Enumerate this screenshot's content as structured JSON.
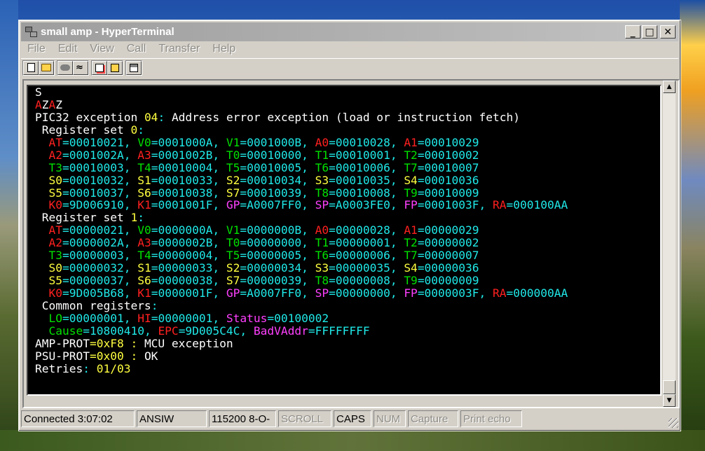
{
  "window": {
    "title": "small amp - HyperTerminal",
    "min_glyph": "_",
    "max_glyph": "□",
    "close_glyph": "✕"
  },
  "menu": [
    "File",
    "Edit",
    "View",
    "Call",
    "Transfer",
    "Help"
  ],
  "toolbar": {
    "icons": [
      "new-icon",
      "open-icon",
      "dial-icon",
      "disconnect-icon",
      "send-icon",
      "receive-icon",
      "properties-icon"
    ]
  },
  "terminal": {
    "lines": [
      [
        {
          "t": "S",
          "c": "wht"
        }
      ],
      [
        {
          "t": "A",
          "c": "red"
        },
        {
          "t": "Z",
          "c": "wht"
        },
        {
          "t": "A",
          "c": "red"
        },
        {
          "t": "Z",
          "c": "wht"
        }
      ],
      [
        {
          "t": "PIC32 exception ",
          "c": "wht"
        },
        {
          "t": "04",
          "c": "yel"
        },
        {
          "t": ": ",
          "c": "cyn"
        },
        {
          "t": "Address error exception (load or instruction fetch)",
          "c": "wht"
        }
      ],
      [
        {
          "t": " Register set ",
          "c": "wht"
        },
        {
          "t": "0",
          "c": "yel"
        },
        {
          "t": ":",
          "c": "cyn"
        }
      ],
      [
        {
          "t": "  ",
          "c": "wht"
        },
        {
          "t": "AT",
          "c": "red"
        },
        {
          "t": "=00010021, ",
          "c": "cyn"
        },
        {
          "t": "V0",
          "c": "grn"
        },
        {
          "t": "=0001000A, ",
          "c": "cyn"
        },
        {
          "t": "V1",
          "c": "grn"
        },
        {
          "t": "=0001000B, ",
          "c": "cyn"
        },
        {
          "t": "A0",
          "c": "red"
        },
        {
          "t": "=00010028, ",
          "c": "cyn"
        },
        {
          "t": "A1",
          "c": "red"
        },
        {
          "t": "=00010029",
          "c": "cyn"
        }
      ],
      [
        {
          "t": "  ",
          "c": "wht"
        },
        {
          "t": "A2",
          "c": "red"
        },
        {
          "t": "=0001002A, ",
          "c": "cyn"
        },
        {
          "t": "A3",
          "c": "red"
        },
        {
          "t": "=0001002B, ",
          "c": "cyn"
        },
        {
          "t": "T0",
          "c": "grn"
        },
        {
          "t": "=00010000, ",
          "c": "cyn"
        },
        {
          "t": "T1",
          "c": "grn"
        },
        {
          "t": "=00010001, ",
          "c": "cyn"
        },
        {
          "t": "T2",
          "c": "grn"
        },
        {
          "t": "=00010002",
          "c": "cyn"
        }
      ],
      [
        {
          "t": "  ",
          "c": "wht"
        },
        {
          "t": "T3",
          "c": "grn"
        },
        {
          "t": "=00010003, ",
          "c": "cyn"
        },
        {
          "t": "T4",
          "c": "grn"
        },
        {
          "t": "=00010004, ",
          "c": "cyn"
        },
        {
          "t": "T5",
          "c": "grn"
        },
        {
          "t": "=00010005, ",
          "c": "cyn"
        },
        {
          "t": "T6",
          "c": "grn"
        },
        {
          "t": "=00010006, ",
          "c": "cyn"
        },
        {
          "t": "T7",
          "c": "grn"
        },
        {
          "t": "=00010007",
          "c": "cyn"
        }
      ],
      [
        {
          "t": "  ",
          "c": "wht"
        },
        {
          "t": "S0",
          "c": "yel"
        },
        {
          "t": "=00010032, ",
          "c": "cyn"
        },
        {
          "t": "S1",
          "c": "yel"
        },
        {
          "t": "=00010033, ",
          "c": "cyn"
        },
        {
          "t": "S2",
          "c": "yel"
        },
        {
          "t": "=00010034, ",
          "c": "cyn"
        },
        {
          "t": "S3",
          "c": "yel"
        },
        {
          "t": "=00010035, ",
          "c": "cyn"
        },
        {
          "t": "S4",
          "c": "yel"
        },
        {
          "t": "=00010036",
          "c": "cyn"
        }
      ],
      [
        {
          "t": "  ",
          "c": "wht"
        },
        {
          "t": "S5",
          "c": "yel"
        },
        {
          "t": "=00010037, ",
          "c": "cyn"
        },
        {
          "t": "S6",
          "c": "yel"
        },
        {
          "t": "=00010038, ",
          "c": "cyn"
        },
        {
          "t": "S7",
          "c": "yel"
        },
        {
          "t": "=00010039, ",
          "c": "cyn"
        },
        {
          "t": "T8",
          "c": "grn"
        },
        {
          "t": "=00010008, ",
          "c": "cyn"
        },
        {
          "t": "T9",
          "c": "grn"
        },
        {
          "t": "=00010009",
          "c": "cyn"
        }
      ],
      [
        {
          "t": "  ",
          "c": "wht"
        },
        {
          "t": "K0",
          "c": "red"
        },
        {
          "t": "=9D006910, ",
          "c": "cyn"
        },
        {
          "t": "K1",
          "c": "red"
        },
        {
          "t": "=0001001F, ",
          "c": "cyn"
        },
        {
          "t": "GP",
          "c": "mag"
        },
        {
          "t": "=A0007FF0, ",
          "c": "cyn"
        },
        {
          "t": "SP",
          "c": "mag"
        },
        {
          "t": "=A0003FE0, ",
          "c": "cyn"
        },
        {
          "t": "FP",
          "c": "mag"
        },
        {
          "t": "=0001003F, ",
          "c": "cyn"
        },
        {
          "t": "RA",
          "c": "red"
        },
        {
          "t": "=000100AA",
          "c": "cyn"
        }
      ],
      [
        {
          "t": " Register set ",
          "c": "wht"
        },
        {
          "t": "1",
          "c": "yel"
        },
        {
          "t": ":",
          "c": "cyn"
        }
      ],
      [
        {
          "t": "  ",
          "c": "wht"
        },
        {
          "t": "AT",
          "c": "red"
        },
        {
          "t": "=00000021, ",
          "c": "cyn"
        },
        {
          "t": "V0",
          "c": "grn"
        },
        {
          "t": "=0000000A, ",
          "c": "cyn"
        },
        {
          "t": "V1",
          "c": "grn"
        },
        {
          "t": "=0000000B, ",
          "c": "cyn"
        },
        {
          "t": "A0",
          "c": "red"
        },
        {
          "t": "=00000028, ",
          "c": "cyn"
        },
        {
          "t": "A1",
          "c": "red"
        },
        {
          "t": "=00000029",
          "c": "cyn"
        }
      ],
      [
        {
          "t": "  ",
          "c": "wht"
        },
        {
          "t": "A2",
          "c": "red"
        },
        {
          "t": "=0000002A, ",
          "c": "cyn"
        },
        {
          "t": "A3",
          "c": "red"
        },
        {
          "t": "=0000002B, ",
          "c": "cyn"
        },
        {
          "t": "T0",
          "c": "grn"
        },
        {
          "t": "=00000000, ",
          "c": "cyn"
        },
        {
          "t": "T1",
          "c": "grn"
        },
        {
          "t": "=00000001, ",
          "c": "cyn"
        },
        {
          "t": "T2",
          "c": "grn"
        },
        {
          "t": "=00000002",
          "c": "cyn"
        }
      ],
      [
        {
          "t": "  ",
          "c": "wht"
        },
        {
          "t": "T3",
          "c": "grn"
        },
        {
          "t": "=00000003, ",
          "c": "cyn"
        },
        {
          "t": "T4",
          "c": "grn"
        },
        {
          "t": "=00000004, ",
          "c": "cyn"
        },
        {
          "t": "T5",
          "c": "grn"
        },
        {
          "t": "=00000005, ",
          "c": "cyn"
        },
        {
          "t": "T6",
          "c": "grn"
        },
        {
          "t": "=00000006, ",
          "c": "cyn"
        },
        {
          "t": "T7",
          "c": "grn"
        },
        {
          "t": "=00000007",
          "c": "cyn"
        }
      ],
      [
        {
          "t": "  ",
          "c": "wht"
        },
        {
          "t": "S0",
          "c": "yel"
        },
        {
          "t": "=00000032, ",
          "c": "cyn"
        },
        {
          "t": "S1",
          "c": "yel"
        },
        {
          "t": "=00000033, ",
          "c": "cyn"
        },
        {
          "t": "S2",
          "c": "yel"
        },
        {
          "t": "=00000034, ",
          "c": "cyn"
        },
        {
          "t": "S3",
          "c": "yel"
        },
        {
          "t": "=00000035, ",
          "c": "cyn"
        },
        {
          "t": "S4",
          "c": "yel"
        },
        {
          "t": "=00000036",
          "c": "cyn"
        }
      ],
      [
        {
          "t": "  ",
          "c": "wht"
        },
        {
          "t": "S5",
          "c": "yel"
        },
        {
          "t": "=00000037, ",
          "c": "cyn"
        },
        {
          "t": "S6",
          "c": "yel"
        },
        {
          "t": "=00000038, ",
          "c": "cyn"
        },
        {
          "t": "S7",
          "c": "yel"
        },
        {
          "t": "=00000039, ",
          "c": "cyn"
        },
        {
          "t": "T8",
          "c": "grn"
        },
        {
          "t": "=00000008, ",
          "c": "cyn"
        },
        {
          "t": "T9",
          "c": "grn"
        },
        {
          "t": "=00000009",
          "c": "cyn"
        }
      ],
      [
        {
          "t": "  ",
          "c": "wht"
        },
        {
          "t": "K0",
          "c": "red"
        },
        {
          "t": "=9D005B68, ",
          "c": "cyn"
        },
        {
          "t": "K1",
          "c": "red"
        },
        {
          "t": "=0000001F, ",
          "c": "cyn"
        },
        {
          "t": "GP",
          "c": "mag"
        },
        {
          "t": "=A0007FF0, ",
          "c": "cyn"
        },
        {
          "t": "SP",
          "c": "mag"
        },
        {
          "t": "=00000000, ",
          "c": "cyn"
        },
        {
          "t": "FP",
          "c": "mag"
        },
        {
          "t": "=0000003F, ",
          "c": "cyn"
        },
        {
          "t": "RA",
          "c": "red"
        },
        {
          "t": "=000000AA",
          "c": "cyn"
        }
      ],
      [
        {
          "t": " Common registers",
          "c": "wht"
        },
        {
          "t": ":",
          "c": "cyn"
        }
      ],
      [
        {
          "t": "  ",
          "c": "wht"
        },
        {
          "t": "LO",
          "c": "grn"
        },
        {
          "t": "=00000001, ",
          "c": "cyn"
        },
        {
          "t": "HI",
          "c": "red"
        },
        {
          "t": "=00000001, ",
          "c": "cyn"
        },
        {
          "t": "Status",
          "c": "mag"
        },
        {
          "t": "=00100002",
          "c": "cyn"
        }
      ],
      [
        {
          "t": "  ",
          "c": "wht"
        },
        {
          "t": "Cause",
          "c": "grn"
        },
        {
          "t": "=10800410, ",
          "c": "cyn"
        },
        {
          "t": "EPC",
          "c": "red"
        },
        {
          "t": "=9D005C4C, ",
          "c": "cyn"
        },
        {
          "t": "BadVAddr",
          "c": "mag"
        },
        {
          "t": "=FFFFFFFF",
          "c": "cyn"
        }
      ],
      [
        {
          "t": "AMP-PROT",
          "c": "wht"
        },
        {
          "t": "=0xF8 : ",
          "c": "yel"
        },
        {
          "t": "MCU exception",
          "c": "wht"
        }
      ],
      [
        {
          "t": "PSU-PROT",
          "c": "wht"
        },
        {
          "t": "=0x00 : ",
          "c": "yel"
        },
        {
          "t": "OK",
          "c": "wht"
        }
      ],
      [
        {
          "t": "Retries",
          "c": "wht"
        },
        {
          "t": ": ",
          "c": "cyn"
        },
        {
          "t": "01/03",
          "c": "yel"
        }
      ]
    ]
  },
  "scrollbar": {
    "up_glyph": "▲",
    "down_glyph": "▼",
    "position": 0.97
  },
  "statusbar": {
    "connected": "Connected 3:07:02",
    "emulation": "ANSIW",
    "port": "115200 8-O-",
    "scroll": "SCROLL",
    "caps": "CAPS",
    "num": "NUM",
    "capture": "Capture",
    "print_echo": "Print echo"
  },
  "colors": {
    "wht": "#ffffff",
    "red": "#ff2020",
    "grn": "#00e000",
    "yel": "#ffff40",
    "cyn": "#20e8e8",
    "mag": "#ff40ff"
  }
}
